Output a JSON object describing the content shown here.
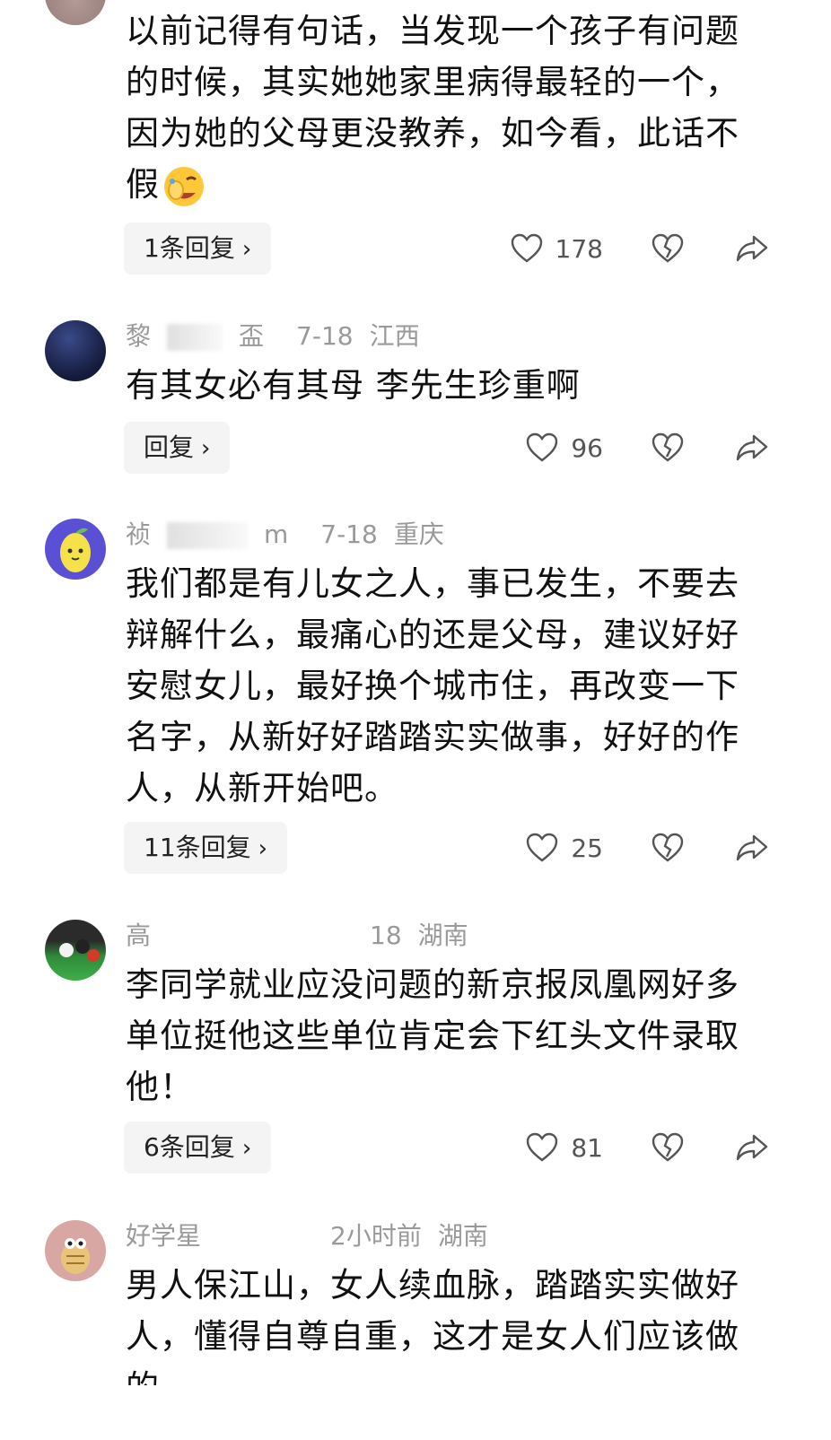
{
  "comments": [
    {
      "user": "",
      "date": "",
      "location": "",
      "lines": [
        "以前记得有句话，当发现一个孩子有问题",
        "的时候，其实她她家里病得最轻的一个，",
        "因为她的父母更没教养，如今看，此话不",
        "假"
      ],
      "emoji": "facepalm-laugh-emoji",
      "replies": "1条回复",
      "likes": "178"
    },
    {
      "user": "黎",
      "user_tail": "盃",
      "date": "7-18",
      "location": "江西",
      "lines": [
        "有其女必有其母 李先生珍重啊"
      ],
      "replies": "回复",
      "likes": "96"
    },
    {
      "user": "祯",
      "user_tail": "m",
      "date": "7-18",
      "location": "重庆",
      "lines": [
        "我们都是有儿女之人，事已发生，不要去",
        "辩解什么，最痛心的还是父母，建议好好",
        "安慰女儿，最好换个城市住，再改变一下",
        "名字，从新好好踏踏实实做事，好好的作",
        "人，从新开始吧。"
      ],
      "replies": "11条回复",
      "likes": "25"
    },
    {
      "user": "高",
      "date": "18",
      "location": "湖南",
      "lines": [
        "李同学就业应没问题的新京报凤凰网好多",
        "单位挺他这些单位肯定会下红头文件录取",
        "他！"
      ],
      "replies": "6条回复",
      "likes": "81"
    },
    {
      "user": "好学星",
      "date": "2小时前",
      "location": "湖南",
      "lines": [
        "男人保江山，女人续血脉，踏踏实实做好",
        "人，懂得自尊自重，这才是女人们应该做",
        "的"
      ]
    }
  ]
}
